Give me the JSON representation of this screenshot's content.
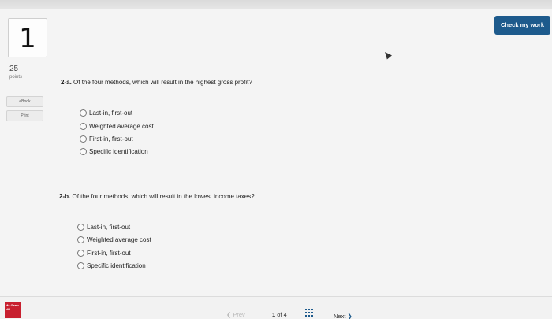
{
  "question": {
    "number": "1",
    "points": "25",
    "points_label": "points"
  },
  "header": {
    "check_button": "Check my work"
  },
  "side": {
    "ebook": "eBook",
    "print": "Print"
  },
  "parts": [
    {
      "label": "2-a.",
      "text": "Of the four methods, which will result in the highest gross profit?",
      "options": [
        "Last-in, first-out",
        "Weighted average cost",
        "First-in, first-out",
        "Specific identification"
      ]
    },
    {
      "label": "2-b.",
      "text": "Of the four methods, which will result in the lowest income taxes?",
      "options": [
        "Last-in, first-out",
        "Weighted average cost",
        "First-in, first-out",
        "Specific identification"
      ]
    }
  ],
  "footer": {
    "logo": "Mc Graw Hill",
    "prev": "Prev",
    "page_current": "1",
    "page_of": "of",
    "page_total": "4",
    "next": "Next"
  }
}
